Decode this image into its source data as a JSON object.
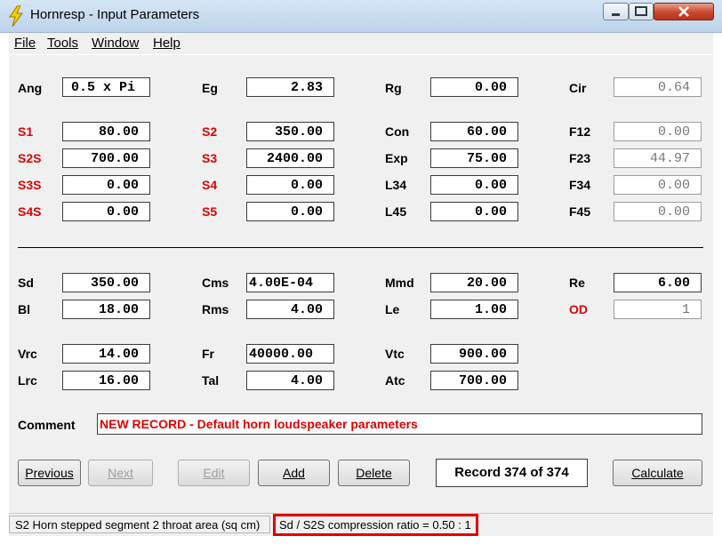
{
  "window": {
    "title": "Hornresp - Input Parameters"
  },
  "menu": [
    "File",
    "Tools",
    "Window",
    "Help"
  ],
  "params": {
    "Ang": "0.5 x Pi",
    "Eg": "2.83",
    "Rg": "0.00",
    "Cir": "0.64",
    "S1": "80.00",
    "S2": "350.00",
    "Con": "60.00",
    "F12": "0.00",
    "S2S": "700.00",
    "S3": "2400.00",
    "Exp": "75.00",
    "F23": "44.97",
    "S3S": "0.00",
    "S4": "0.00",
    "L34": "0.00",
    "F34": "0.00",
    "S4S": "0.00",
    "S5": "0.00",
    "L45": "0.00",
    "F45": "0.00",
    "Sd": "350.00",
    "Cms": "4.00E-04",
    "Mmd": "20.00",
    "Re": "6.00",
    "Bl": "18.00",
    "Rms": "4.00",
    "Le": "1.00",
    "OD": "1",
    "Vrc": "14.00",
    "Fr": "40000.00",
    "Vtc": "900.00",
    "Lrc": "16.00",
    "Tal": "4.00",
    "Atc": "700.00"
  },
  "comment": {
    "label": "Comment",
    "value": "NEW RECORD - Default horn loudspeaker parameters"
  },
  "buttons": {
    "previous": "Previous",
    "next": "Next",
    "edit": "Edit",
    "add": "Add",
    "delete": "Delete",
    "calculate": "Calculate"
  },
  "record": "Record 374 of 374",
  "status": {
    "left": "S2   Horn stepped segment 2 throat area  (sq cm)",
    "right": "Sd / S2S compression ratio = 0.50 : 1"
  },
  "colors": {
    "red_label": "#e00000",
    "highlight_border": "#e00000"
  }
}
